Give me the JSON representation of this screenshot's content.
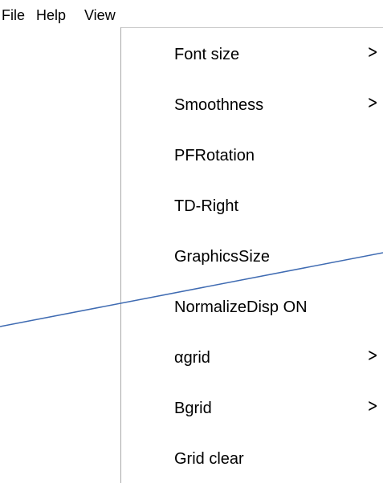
{
  "menubar": {
    "items": [
      {
        "label": "File"
      },
      {
        "label": "Help"
      },
      {
        "label": "View"
      }
    ]
  },
  "view_menu": {
    "items": [
      {
        "label": "Font size",
        "submenu": true
      },
      {
        "label": "Smoothness",
        "submenu": true
      },
      {
        "label": "PFRotation",
        "submenu": false
      },
      {
        "label": "TD-Right",
        "submenu": false
      },
      {
        "label": "GraphicsSize",
        "submenu": false
      },
      {
        "label": "NormalizeDisp ON",
        "submenu": false
      },
      {
        "label": "αgrid",
        "submenu": true
      },
      {
        "label": "Bgrid",
        "submenu": true
      },
      {
        "label": "Grid clear",
        "submenu": false
      }
    ],
    "submenu_arrow": ">"
  },
  "colors": {
    "overlay_line": "#3f6bb2",
    "menu_border": "#a9a9a9"
  }
}
